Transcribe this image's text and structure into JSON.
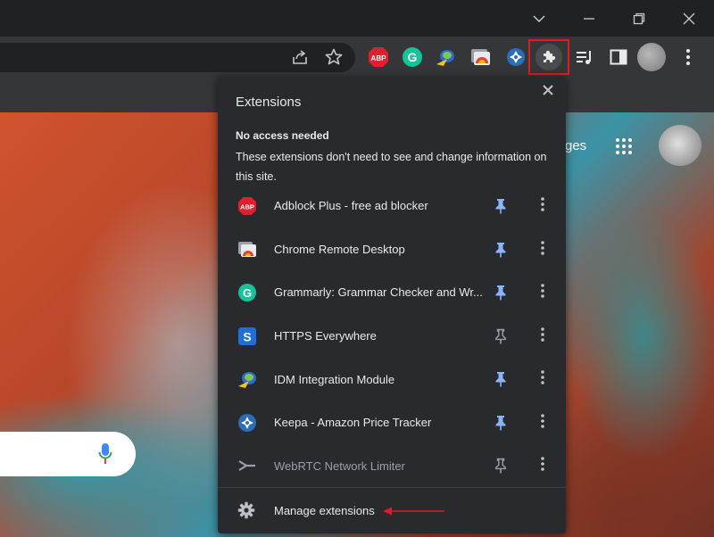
{
  "toolbar": {
    "extension_icons": [
      "adblock-plus-icon",
      "grammarly-icon",
      "idm-icon",
      "chrome-remote-desktop-icon",
      "keepa-icon",
      "puzzle-icon"
    ]
  },
  "page": {
    "apps_partial_text": "ges"
  },
  "popup": {
    "title": "Extensions",
    "section_heading": "No access needed",
    "section_description": "These extensions don't need to see and change information on this site.",
    "extensions": [
      {
        "name": "Adblock Plus - free ad blocker",
        "pinned": true
      },
      {
        "name": "Chrome Remote Desktop",
        "pinned": true
      },
      {
        "name": "Grammarly: Grammar Checker and Wr...",
        "pinned": true
      },
      {
        "name": "HTTPS Everywhere",
        "pinned": false
      },
      {
        "name": "IDM Integration Module",
        "pinned": true
      },
      {
        "name": "Keepa - Amazon Price Tracker",
        "pinned": true
      },
      {
        "name": "WebRTC Network Limiter",
        "pinned": false
      }
    ],
    "manage_label": "Manage extensions"
  },
  "colors": {
    "pinned": "#8ab4f8",
    "unpinned": "#9aa0a6",
    "highlight": "#e01b24"
  }
}
